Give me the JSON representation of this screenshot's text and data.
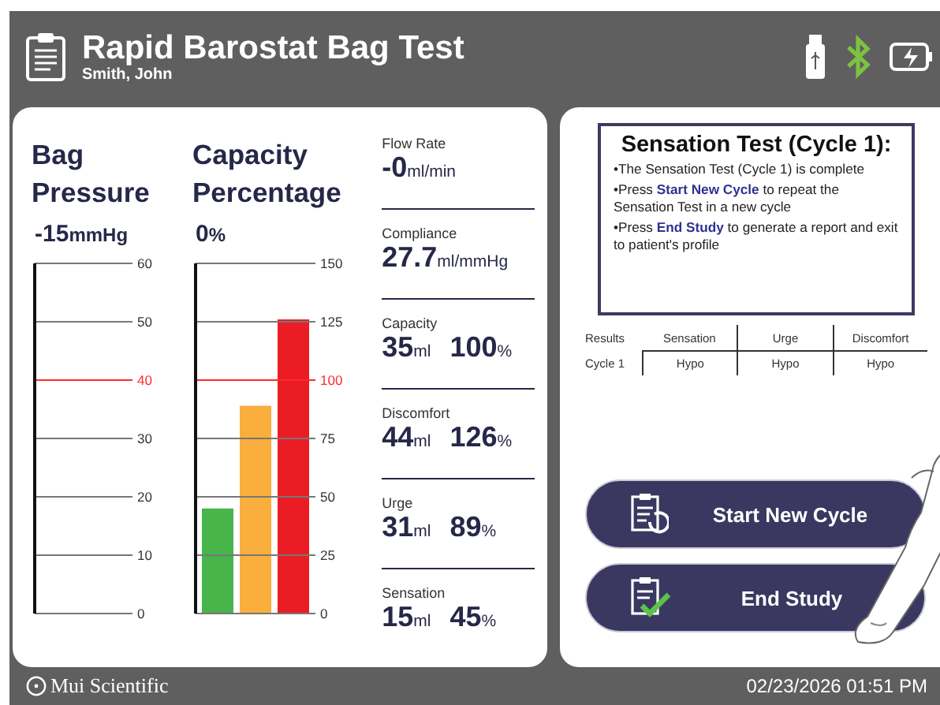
{
  "header": {
    "title": "Rapid Barostat Bag Test",
    "patient": "Smith, John"
  },
  "pressure": {
    "title_lines": [
      "Bag",
      "Pressure"
    ],
    "value": "-15",
    "unit": "mmHg",
    "scale": {
      "ticks": [
        {
          "label": "60",
          "alarm": false
        },
        {
          "label": "50",
          "alarm": false
        },
        {
          "label": "40",
          "alarm": true
        },
        {
          "label": "30",
          "alarm": false
        },
        {
          "label": "20",
          "alarm": false
        },
        {
          "label": "10",
          "alarm": false
        },
        {
          "label": "0",
          "alarm": false
        }
      ]
    }
  },
  "capacity": {
    "title_lines": [
      "Capacity",
      "Percentage"
    ],
    "value": "0",
    "unit": "%",
    "chart_data": {
      "type": "bar",
      "ylim": [
        0,
        150
      ],
      "yticks": [
        0,
        25,
        50,
        75,
        100,
        125,
        150
      ],
      "grid": true,
      "ref_lines": [
        {
          "axis": "y",
          "value": 100,
          "color": "#ff2a2a"
        }
      ],
      "series": [
        {
          "color": "#47b549",
          "values": [
            45
          ]
        },
        {
          "color": "#f9ae3d",
          "values": [
            89
          ]
        },
        {
          "color": "#ec1c24",
          "values": [
            126
          ]
        }
      ]
    }
  },
  "stats": [
    {
      "label": "Flow Rate",
      "value": "-0",
      "unit": "ml/min"
    },
    {
      "label": "Compliance",
      "value": "27.7",
      "unit": "ml/mmHg"
    },
    {
      "label": "Capacity",
      "value": "35",
      "unit": "ml",
      "percent": "100",
      "percent_unit": "%"
    },
    {
      "label": "Discomfort",
      "value": "44",
      "unit": "ml",
      "percent": "126",
      "percent_unit": "%"
    },
    {
      "label": "Urge",
      "value": "31",
      "unit": "ml",
      "percent": "89",
      "percent_unit": "%"
    },
    {
      "label": "Sensation",
      "value": "15",
      "unit": "ml",
      "percent": "45",
      "percent_unit": "%"
    }
  ],
  "message": {
    "title": "Sensation Test (Cycle 1):",
    "lines": [
      "•The Sensation Test (Cycle 1) is complete",
      "•Press **Start New Cycle** to repeat the Sensation Test in a new cycle",
      "•Press **End Study** to generate a report and exit to patient's profile"
    ]
  },
  "results": {
    "title": "Results",
    "columns": [
      "Sensation",
      "Urge",
      "Discomfort"
    ],
    "rows": [
      {
        "label": "Cycle 1",
        "cells": [
          "Hypo",
          "Hypo",
          "Hypo"
        ]
      }
    ]
  },
  "buttons": [
    {
      "kind": "restart",
      "label": "Start New Cycle"
    },
    {
      "kind": "finish",
      "label": "End Study"
    }
  ],
  "footer": {
    "brand": "Mui Scientific",
    "datetime": "02/23/2026 01:51 PM"
  }
}
